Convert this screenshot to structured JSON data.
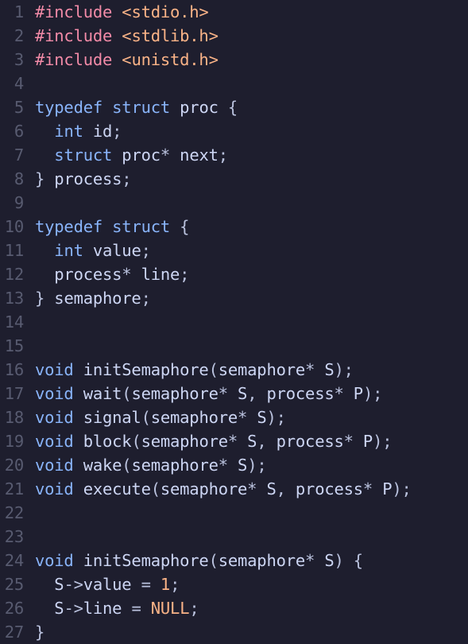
{
  "colors": {
    "background": "#1e1e2e",
    "line_number": "#585b70",
    "preprocessor": "#f38ba8",
    "header": "#fab387",
    "keyword": "#89b4fa",
    "identifier": "#cdd6f4",
    "number": "#fab387"
  },
  "lines": [
    {
      "n": "1",
      "tokens": [
        [
          "pre",
          "#include"
        ],
        [
          "id",
          " "
        ],
        [
          "hdr",
          "<stdio.h>"
        ]
      ]
    },
    {
      "n": "2",
      "tokens": [
        [
          "pre",
          "#include"
        ],
        [
          "id",
          " "
        ],
        [
          "hdr",
          "<stdlib.h>"
        ]
      ]
    },
    {
      "n": "3",
      "tokens": [
        [
          "pre",
          "#include"
        ],
        [
          "id",
          " "
        ],
        [
          "hdr",
          "<unistd.h>"
        ]
      ]
    },
    {
      "n": "4",
      "tokens": []
    },
    {
      "n": "5",
      "tokens": [
        [
          "kw",
          "typedef"
        ],
        [
          "id",
          " "
        ],
        [
          "kw",
          "struct"
        ],
        [
          "id",
          " proc "
        ],
        [
          "pun",
          "{"
        ]
      ]
    },
    {
      "n": "6",
      "tokens": [
        [
          "id",
          "  "
        ],
        [
          "ty",
          "int"
        ],
        [
          "id",
          " id"
        ],
        [
          "pun",
          ";"
        ]
      ]
    },
    {
      "n": "7",
      "tokens": [
        [
          "id",
          "  "
        ],
        [
          "kw",
          "struct"
        ],
        [
          "id",
          " proc"
        ],
        [
          "op",
          "*"
        ],
        [
          "id",
          " next"
        ],
        [
          "pun",
          ";"
        ]
      ]
    },
    {
      "n": "8",
      "tokens": [
        [
          "pun",
          "}"
        ],
        [
          "id",
          " process"
        ],
        [
          "pun",
          ";"
        ]
      ]
    },
    {
      "n": "9",
      "tokens": []
    },
    {
      "n": "10",
      "tokens": [
        [
          "kw",
          "typedef"
        ],
        [
          "id",
          " "
        ],
        [
          "kw",
          "struct"
        ],
        [
          "id",
          " "
        ],
        [
          "pun",
          "{"
        ]
      ]
    },
    {
      "n": "11",
      "tokens": [
        [
          "id",
          "  "
        ],
        [
          "ty",
          "int"
        ],
        [
          "id",
          " value"
        ],
        [
          "pun",
          ";"
        ]
      ]
    },
    {
      "n": "12",
      "tokens": [
        [
          "id",
          "  process"
        ],
        [
          "op",
          "*"
        ],
        [
          "id",
          " line"
        ],
        [
          "pun",
          ";"
        ]
      ]
    },
    {
      "n": "13",
      "tokens": [
        [
          "pun",
          "}"
        ],
        [
          "id",
          " semaphore"
        ],
        [
          "pun",
          ";"
        ]
      ]
    },
    {
      "n": "14",
      "tokens": []
    },
    {
      "n": "15",
      "tokens": []
    },
    {
      "n": "16",
      "tokens": [
        [
          "ty",
          "void"
        ],
        [
          "id",
          " initSemaphore"
        ],
        [
          "pun",
          "("
        ],
        [
          "id",
          "semaphore"
        ],
        [
          "op",
          "*"
        ],
        [
          "id",
          " S"
        ],
        [
          "pun",
          ");"
        ]
      ]
    },
    {
      "n": "17",
      "tokens": [
        [
          "ty",
          "void"
        ],
        [
          "id",
          " wait"
        ],
        [
          "pun",
          "("
        ],
        [
          "id",
          "semaphore"
        ],
        [
          "op",
          "*"
        ],
        [
          "id",
          " S"
        ],
        [
          "pun",
          ","
        ],
        [
          "id",
          " process"
        ],
        [
          "op",
          "*"
        ],
        [
          "id",
          " P"
        ],
        [
          "pun",
          ");"
        ]
      ]
    },
    {
      "n": "18",
      "tokens": [
        [
          "ty",
          "void"
        ],
        [
          "id",
          " signal"
        ],
        [
          "pun",
          "("
        ],
        [
          "id",
          "semaphore"
        ],
        [
          "op",
          "*"
        ],
        [
          "id",
          " S"
        ],
        [
          "pun",
          ");"
        ]
      ]
    },
    {
      "n": "19",
      "tokens": [
        [
          "ty",
          "void"
        ],
        [
          "id",
          " block"
        ],
        [
          "pun",
          "("
        ],
        [
          "id",
          "semaphore"
        ],
        [
          "op",
          "*"
        ],
        [
          "id",
          " S"
        ],
        [
          "pun",
          ","
        ],
        [
          "id",
          " process"
        ],
        [
          "op",
          "*"
        ],
        [
          "id",
          " P"
        ],
        [
          "pun",
          ");"
        ]
      ]
    },
    {
      "n": "20",
      "tokens": [
        [
          "ty",
          "void"
        ],
        [
          "id",
          " wake"
        ],
        [
          "pun",
          "("
        ],
        [
          "id",
          "semaphore"
        ],
        [
          "op",
          "*"
        ],
        [
          "id",
          " S"
        ],
        [
          "pun",
          ");"
        ]
      ]
    },
    {
      "n": "21",
      "tokens": [
        [
          "ty",
          "void"
        ],
        [
          "id",
          " execute"
        ],
        [
          "pun",
          "("
        ],
        [
          "id",
          "semaphore"
        ],
        [
          "op",
          "*"
        ],
        [
          "id",
          " S"
        ],
        [
          "pun",
          ","
        ],
        [
          "id",
          " process"
        ],
        [
          "op",
          "*"
        ],
        [
          "id",
          " P"
        ],
        [
          "pun",
          ");"
        ]
      ]
    },
    {
      "n": "22",
      "tokens": []
    },
    {
      "n": "23",
      "tokens": []
    },
    {
      "n": "24",
      "tokens": [
        [
          "ty",
          "void"
        ],
        [
          "id",
          " initSemaphore"
        ],
        [
          "pun",
          "("
        ],
        [
          "id",
          "semaphore"
        ],
        [
          "op",
          "*"
        ],
        [
          "id",
          " S"
        ],
        [
          "pun",
          ")"
        ],
        [
          "id",
          " "
        ],
        [
          "pun",
          "{"
        ]
      ]
    },
    {
      "n": "25",
      "tokens": [
        [
          "id",
          "  S"
        ],
        [
          "op",
          "->"
        ],
        [
          "id",
          "value "
        ],
        [
          "op",
          "="
        ],
        [
          "id",
          " "
        ],
        [
          "num",
          "1"
        ],
        [
          "pun",
          ";"
        ]
      ]
    },
    {
      "n": "26",
      "tokens": [
        [
          "id",
          "  S"
        ],
        [
          "op",
          "->"
        ],
        [
          "id",
          "line "
        ],
        [
          "op",
          "="
        ],
        [
          "id",
          " "
        ],
        [
          "num",
          "NULL"
        ],
        [
          "pun",
          ";"
        ]
      ]
    },
    {
      "n": "27",
      "tokens": [
        [
          "pun",
          "}"
        ]
      ]
    }
  ]
}
